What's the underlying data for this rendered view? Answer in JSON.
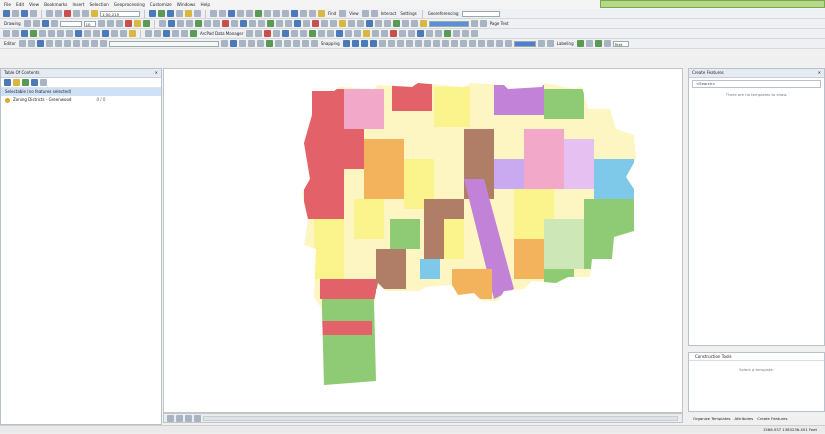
{
  "menu": [
    "File",
    "Edit",
    "View",
    "Bookmarks",
    "Insert",
    "Selection",
    "Geoprocessing",
    "Customize",
    "Windows",
    "Help"
  ],
  "toolbar": {
    "scale": "1:50,215",
    "drawing_label": "Drawing",
    "font_size": "10",
    "find_label": "Find",
    "view_label": "View",
    "interact_label": "Interact",
    "settings_label": "Settings",
    "georeferencing_label": "Georeferencing",
    "page_text_label": "Page Text",
    "arcpad_label": "ArcPad Data Manager",
    "editor_label": "Editor",
    "snapping_label": "Snapping",
    "labeling_label": "Labeling",
    "label_field": "Text"
  },
  "toc": {
    "title": "Table Of Contents",
    "selectable_row": "Selectable (no features selected)",
    "layer_name": "Zoning Districts - Greenwood",
    "layer_count": "0 / 0"
  },
  "create_features": {
    "title": "Create Features",
    "search_placeholder": "<Search>",
    "empty_message": "There are no templates to show.",
    "construction_title": "Construction Tools",
    "construction_message": "Select a template.",
    "organize_label": "Organize Templates",
    "attributes_label": "Attributes",
    "create_label": "Create Features"
  },
  "status": {
    "coordinates": "1566.537 1383236.401 Feet"
  },
  "colors": {
    "residential_yellow": "#fbf38c",
    "pale_yellow": "#fdf6c3",
    "orange": "#f3b35c",
    "red": "#e3626a",
    "green": "#8fcb74",
    "brown": "#b07e67",
    "purple": "#c282d8",
    "blue": "#7ec8ea",
    "pink": "#f2a8c8",
    "light_green": "#cde8b6"
  }
}
